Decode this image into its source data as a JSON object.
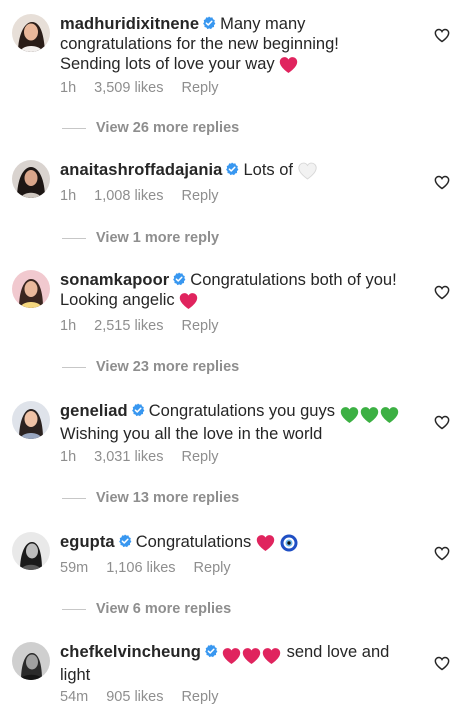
{
  "comments": [
    {
      "username": "madhuridixitnene",
      "lines": [
        "Many many",
        "congratulations for the new beginning!",
        "Sending lots of love your way"
      ],
      "time": "1h",
      "likes": "3,509 likes",
      "reply": "Reply",
      "view_replies": "View 26 more replies",
      "trailing_emoji": [
        "red-heart-emoji"
      ]
    },
    {
      "username": "anaitashroffadajania",
      "lines": [
        "Lots of"
      ],
      "time": "1h",
      "likes": "1,008 likes",
      "reply": "Reply",
      "view_replies": "View 1 more reply",
      "trailing_emoji": [
        "white-heart-emoji"
      ]
    },
    {
      "username": "sonamkapoor",
      "lines": [
        "Congratulations both of you!",
        "Looking angelic"
      ],
      "time": "1h",
      "likes": "2,515 likes",
      "reply": "Reply",
      "view_replies": "View 23 more replies",
      "trailing_emoji": [
        "red-heart-emoji"
      ]
    },
    {
      "username": "geneliad",
      "lines": [
        "Congratulations you guys",
        "Wishing you all the love in the world"
      ],
      "time": "1h",
      "likes": "3,031 likes",
      "reply": "Reply",
      "view_replies": "View 13 more replies",
      "trailing_emoji": [
        "green-heart-emoji",
        "green-heart-emoji",
        "green-heart-emoji"
      ]
    },
    {
      "username": "egupta",
      "lines": [
        "Congratulations"
      ],
      "time": "59m",
      "likes": "1,106 likes",
      "reply": "Reply",
      "view_replies": "View 6 more replies",
      "trailing_emoji": [
        "red-heart-emoji",
        "nazar-amulet-emoji"
      ]
    },
    {
      "username": "chefkelvincheung",
      "lines": [
        "send love and",
        "light"
      ],
      "time": "54m",
      "likes": "905 likes",
      "reply": "Reply",
      "leading_emoji": [
        "red-heart-emoji",
        "red-heart-emoji",
        "red-heart-emoji"
      ]
    }
  ],
  "colors": {
    "text": "#262626",
    "muted": "#8e8e8e",
    "verified": "#3897f0",
    "red_heart": "#e0245e",
    "green_heart": "#3cb043"
  },
  "icons": {
    "verified": "verified-badge-icon",
    "like": "heart-outline-icon"
  }
}
